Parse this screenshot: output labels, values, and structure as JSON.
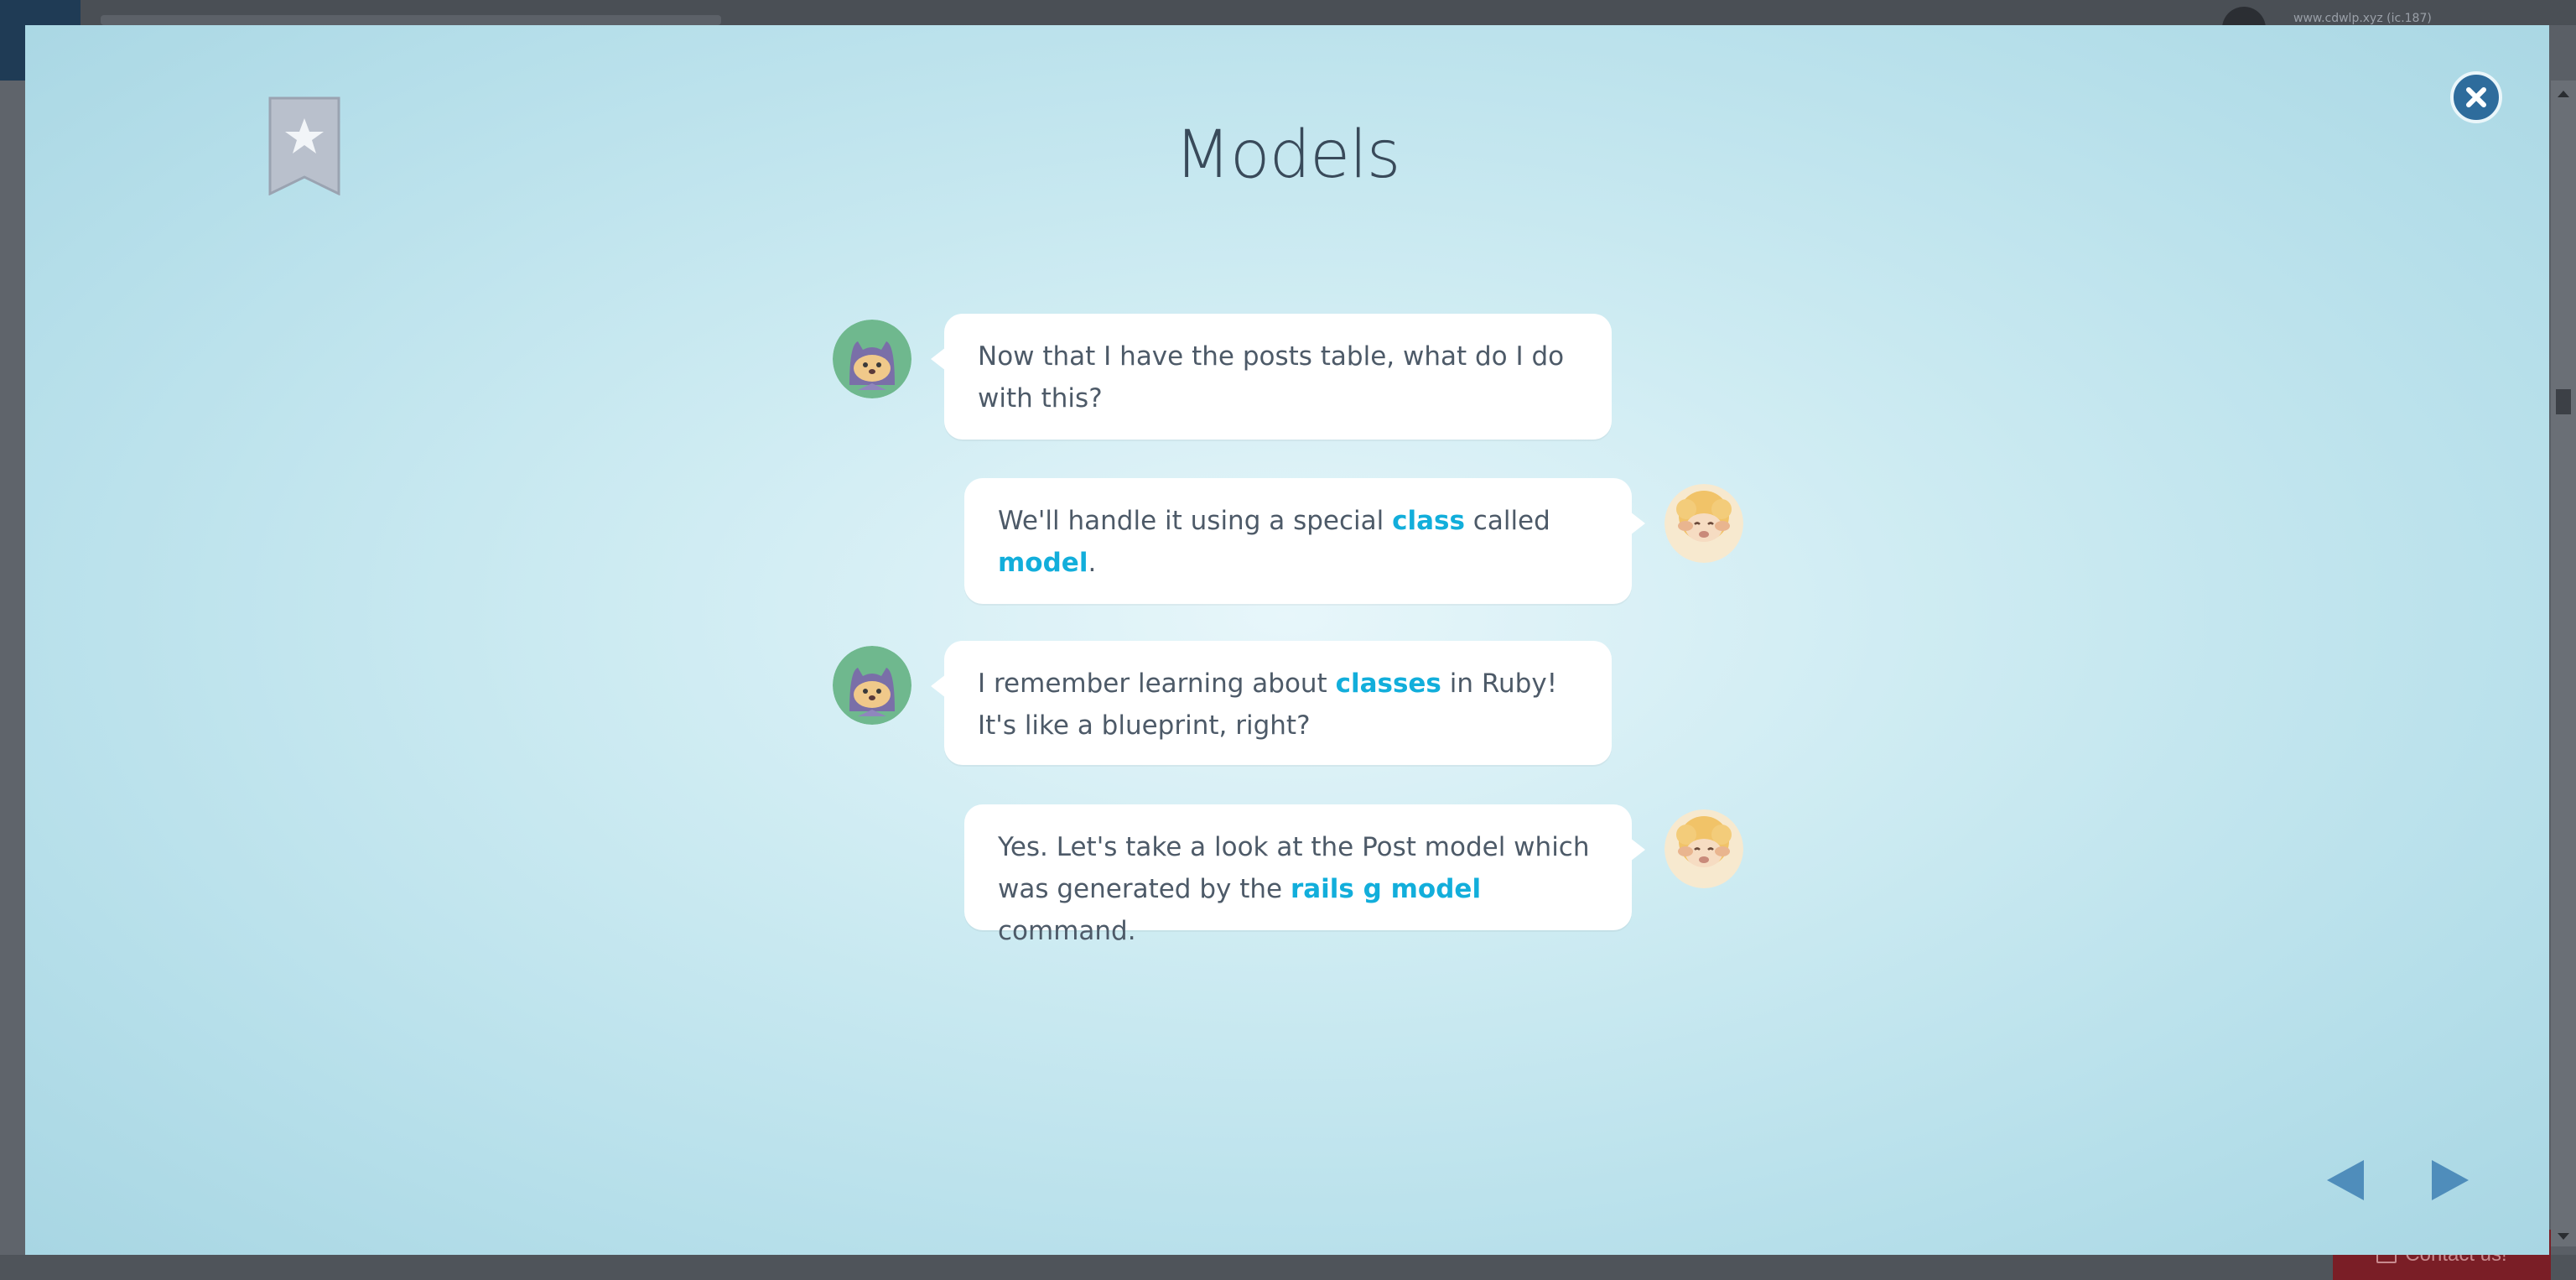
{
  "background": {
    "url_text": "www.cdwlp.xyz (ic.187)",
    "contact_label": "Contact us!"
  },
  "lesson": {
    "title": "Models",
    "bookmark_icon": "star-bookmark-icon",
    "close_icon": "close-icon"
  },
  "dialogue": [
    {
      "speaker": "cat",
      "side": "left",
      "parts": [
        {
          "text": "Now that I have the posts table, what do I do with this?",
          "kw": false
        }
      ]
    },
    {
      "speaker": "sheep",
      "side": "right",
      "parts": [
        {
          "text": "We'll handle it using a special ",
          "kw": false
        },
        {
          "text": "class",
          "kw": true
        },
        {
          "text": " called ",
          "kw": false
        },
        {
          "text": "model",
          "kw": true
        },
        {
          "text": ".",
          "kw": false
        }
      ]
    },
    {
      "speaker": "cat",
      "side": "left",
      "parts": [
        {
          "text": "I remember learning about ",
          "kw": false
        },
        {
          "text": "classes",
          "kw": true
        },
        {
          "text": " in Ruby! It's like a blueprint, right?",
          "kw": false
        }
      ]
    },
    {
      "speaker": "sheep",
      "side": "right",
      "parts": [
        {
          "text": "Yes. Let's take a look at the Post model which was generated by the ",
          "kw": false
        },
        {
          "text": "rails g model",
          "kw": true
        },
        {
          "text": " command.",
          "kw": false
        }
      ]
    }
  ],
  "navigation": {
    "prev_icon": "left-arrow-icon",
    "next_icon": "right-arrow-icon"
  },
  "colors": {
    "keyword": "#12aedb",
    "text": "#4d5a68",
    "title": "#394a5a",
    "nav": "#4f8dbb",
    "close_bg": "#2e6c9c"
  }
}
